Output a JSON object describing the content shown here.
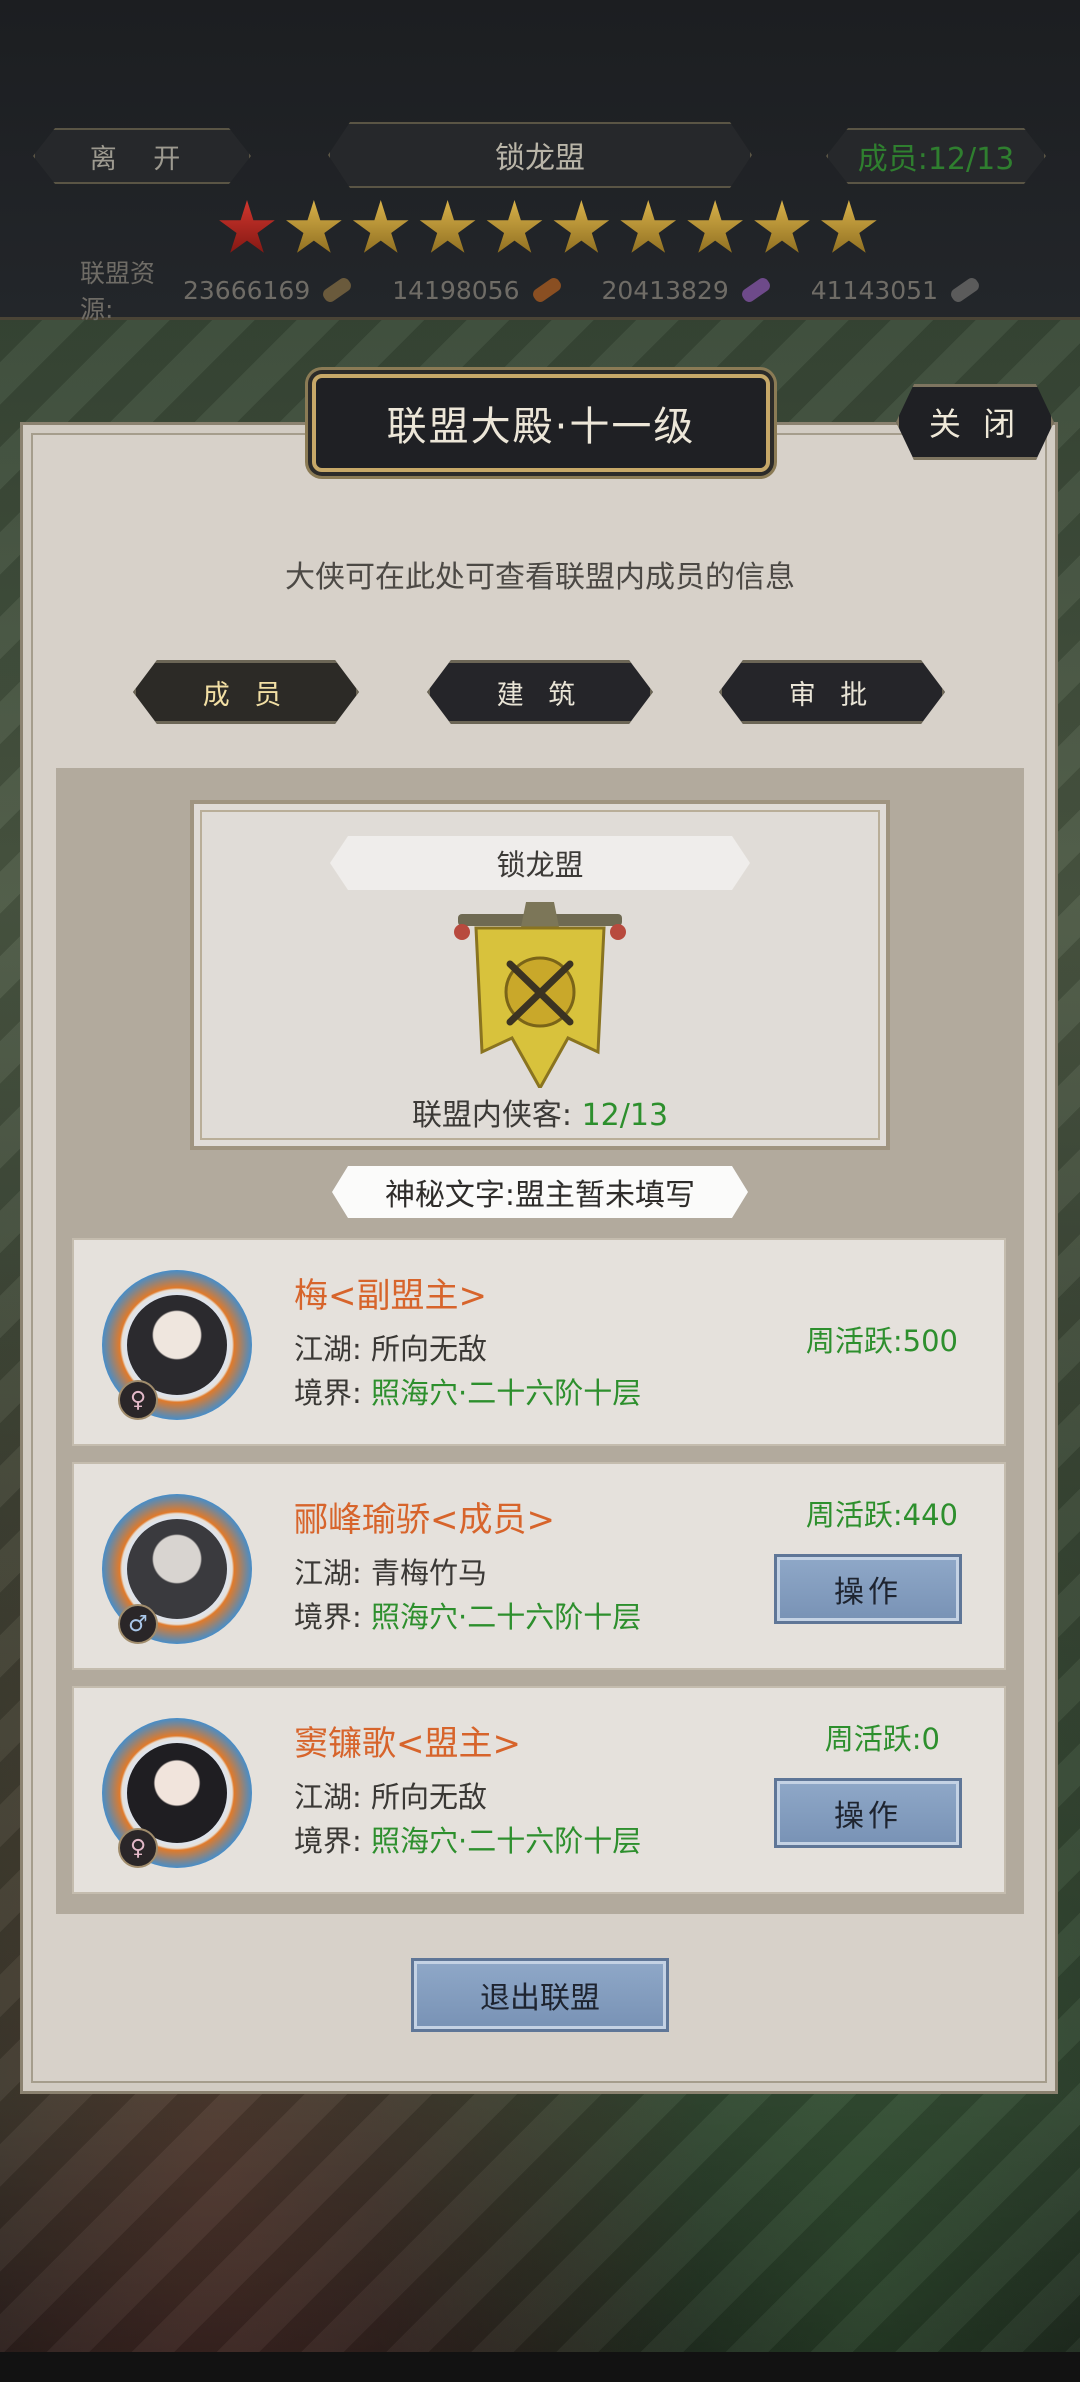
{
  "header": {
    "leave_label": "离 开",
    "alliance_name": "锁龙盟",
    "member_count": "成员:12/13",
    "stars_total": 10,
    "stars_red": 1,
    "resources_label": "联盟资源:",
    "resources": [
      {
        "value": "23666169",
        "icon": "wood-icon",
        "color": "#6a5a3c"
      },
      {
        "value": "14198056",
        "icon": "scroll-icon",
        "color": "#8a4f22"
      },
      {
        "value": "20413829",
        "icon": "crystal-icon",
        "color": "#6e4a8a"
      },
      {
        "value": "41143051",
        "icon": "metal-icon",
        "color": "#5b5b5b"
      }
    ]
  },
  "panel": {
    "title": "联盟大殿·十一级",
    "close_label": "关 闭",
    "intro": "大侠可在此处可查看联盟内成员的信息",
    "tabs": [
      {
        "label": "成 员",
        "active": true
      },
      {
        "label": "建 筑",
        "active": false
      },
      {
        "label": "审 批",
        "active": false
      }
    ]
  },
  "alliance_info": {
    "name": "锁龙盟",
    "members_label": "联盟内侠客:",
    "members_value": "12/13",
    "motto": "神秘文字:盟主暂未填写"
  },
  "members": [
    {
      "name": "梅<副盟主>",
      "jianghu_label": "江湖:",
      "jianghu": "所向无敌",
      "realm_label": "境界:",
      "realm": "照海穴·二十六阶十层",
      "active": "周活跃:500",
      "gender": "♀",
      "has_op": false
    },
    {
      "name": "郦峰瑜骄<成员>",
      "jianghu_label": "江湖:",
      "jianghu": "青梅竹马",
      "realm_label": "境界:",
      "realm": "照海穴·二十六阶十层",
      "active": "周活跃:440",
      "gender": "♂",
      "has_op": true,
      "op_label": "操作"
    },
    {
      "name": "窦镰歌<盟主>",
      "jianghu_label": "江湖:",
      "jianghu": "所向无敌",
      "realm_label": "境界:",
      "realm": "照海穴·二十六阶十层",
      "active": "周活跃:0",
      "gender": "♀",
      "has_op": true,
      "op_label": "操作"
    }
  ],
  "quit_label": "退出联盟",
  "colors": {
    "accent_green": "#2d8f2d",
    "name_orange": "#d7642b",
    "button_blue": "#8fa8c8"
  }
}
